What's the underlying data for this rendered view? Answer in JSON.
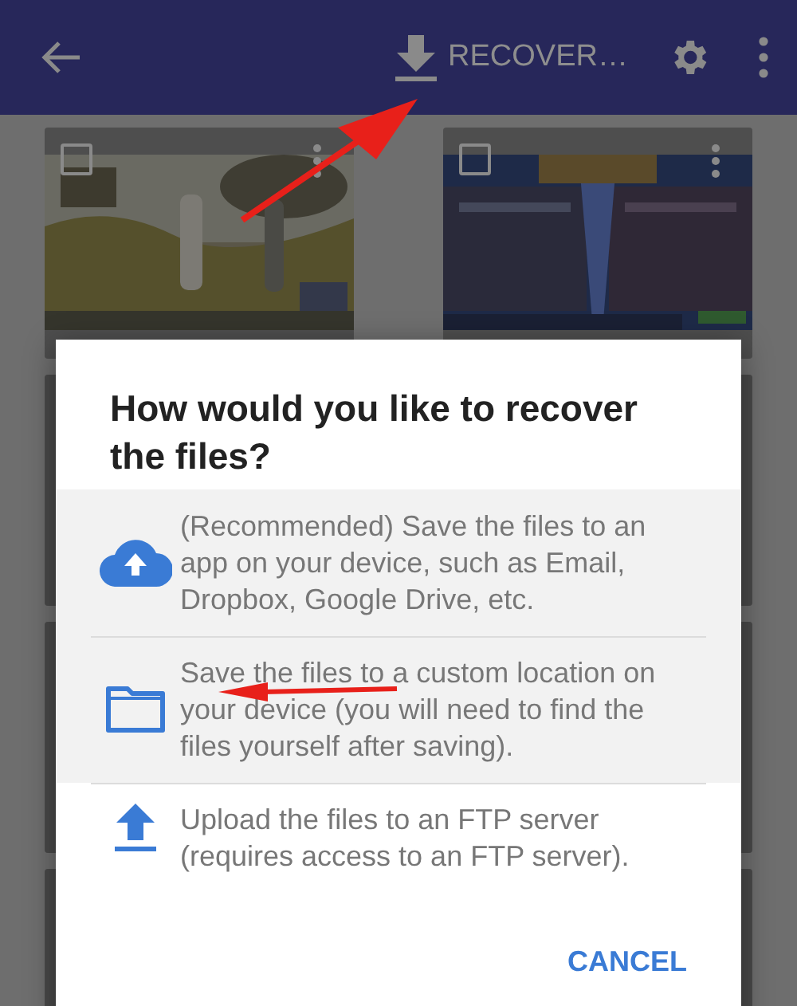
{
  "app_bar": {
    "action_label": "RECOVER…"
  },
  "thumbnails": [
    {
      "checked": false
    },
    {
      "checked": false
    }
  ],
  "dialog": {
    "title": "How would you like to recover the files?",
    "options": [
      {
        "kind": "cloud",
        "text": "(Recommended) Save the files to an app on your device, such as Email, Dropbox, Google Drive, etc.",
        "highlighted": true
      },
      {
        "kind": "folder",
        "text": "Save the files to a custom location on your device (you will need to find the files yourself after saving).",
        "highlighted": true
      },
      {
        "kind": "upload",
        "text": "Upload the files to an FTP server (requires access to an FTP server).",
        "highlighted": false
      }
    ],
    "button": "CANCEL"
  }
}
